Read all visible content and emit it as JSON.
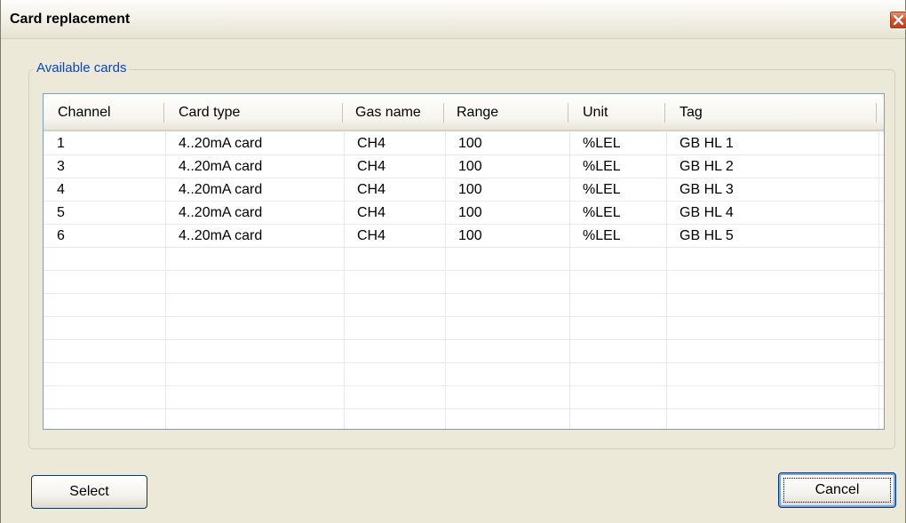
{
  "window": {
    "title": "Card replacement"
  },
  "group": {
    "label": "Available cards"
  },
  "table": {
    "columns": [
      "Channel",
      "Card type",
      "Gas name",
      "Range",
      "Unit",
      "Tag"
    ],
    "rows": [
      [
        "1",
        "4..20mA card",
        "CH4",
        "100",
        "%LEL",
        "GB HL 1"
      ],
      [
        "3",
        "4..20mA card",
        "CH4",
        "100",
        "%LEL",
        "GB HL 2"
      ],
      [
        "4",
        "4..20mA card",
        "CH4",
        "100",
        "%LEL",
        "GB HL 3"
      ],
      [
        "5",
        "4..20mA card",
        "CH4",
        "100",
        "%LEL",
        "GB HL 4"
      ],
      [
        "6",
        "4..20mA card",
        "CH4",
        "100",
        "%LEL",
        "GB HL 5"
      ]
    ]
  },
  "buttons": {
    "select_label": "Select",
    "cancel_label": "Cancel"
  },
  "colors": {
    "group_label": "#0046d5",
    "close_button": "#d7532f",
    "dialog_background": "#ece9d8"
  },
  "icons": {
    "close": "close-icon"
  }
}
